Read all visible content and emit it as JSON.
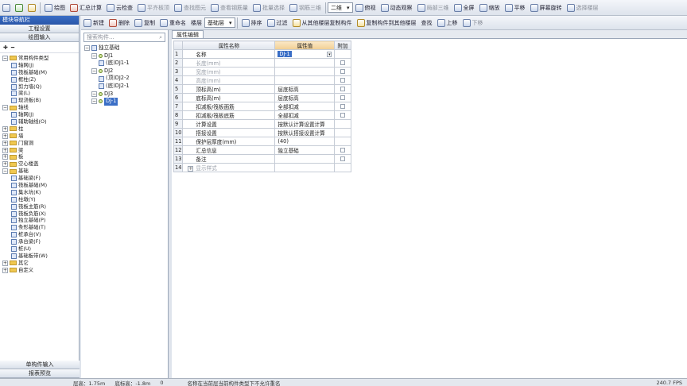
{
  "toolbar_main": {
    "items": [
      {
        "label": "",
        "icon": "open-icon"
      },
      {
        "label": "",
        "icon": "save-icon"
      },
      {
        "label": "",
        "icon": "undo-icon"
      },
      {
        "label": "绘图",
        "icon": "draw-icon"
      },
      {
        "label": "汇总计算",
        "icon": "sum-icon"
      },
      {
        "label": "云检查",
        "icon": "cloud-check-icon"
      },
      {
        "label": "平齐板顶",
        "icon": "align-icon"
      },
      {
        "label": "查找图元",
        "icon": "find-icon"
      },
      {
        "label": "查看钢筋量",
        "icon": "rebar-icon"
      },
      {
        "label": "批量选择",
        "icon": "batch-icon"
      },
      {
        "label": "钢筋三维",
        "icon": "3d-rebar-icon"
      }
    ],
    "view_mode": "二维",
    "items_right": [
      {
        "label": "俯视",
        "icon": "top-view-icon"
      },
      {
        "label": "动态观察",
        "icon": "orbit-icon"
      },
      {
        "label": "局部三维",
        "icon": "local-3d-icon"
      },
      {
        "label": "全屏",
        "icon": "fullscreen-icon"
      },
      {
        "label": "缩放",
        "icon": "zoom-icon"
      },
      {
        "label": "平移",
        "icon": "pan-icon"
      },
      {
        "label": "屏幕旋转",
        "icon": "rotate-icon"
      },
      {
        "label": "选择楼层",
        "icon": "floor-icon"
      }
    ]
  },
  "toolbar_second": {
    "items": [
      {
        "label": "新建",
        "icon": "new-icon"
      },
      {
        "label": "删除",
        "icon": "delete-icon"
      },
      {
        "label": "复制",
        "icon": "copy-icon"
      },
      {
        "label": "重命名",
        "icon": "rename-icon"
      },
      {
        "label": "楼层",
        "icon": ""
      }
    ],
    "floor_value": "基础层",
    "items_right": [
      {
        "label": "排序",
        "icon": "sort-icon"
      },
      {
        "label": "过滤",
        "icon": "filter-icon"
      },
      {
        "label": "从其他楼层复制构件",
        "icon": "copy-from-floor-icon"
      },
      {
        "label": "复制构件到其他楼层",
        "icon": "copy-to-floor-icon"
      },
      {
        "label": "查找",
        "icon": ""
      },
      {
        "label": "上移",
        "icon": "up-icon"
      },
      {
        "label": "下移",
        "icon": "down-icon"
      }
    ]
  },
  "nav": {
    "title": "模块导航栏",
    "buttons": [
      "工程设置",
      "绘图输入"
    ],
    "tree": [
      {
        "label": "常用构件类型",
        "level": 0,
        "type": "folder",
        "expanded": true
      },
      {
        "label": "轴网(J)",
        "level": 1,
        "type": "leaf"
      },
      {
        "label": "筏板基础(M)",
        "level": 1,
        "type": "leaf"
      },
      {
        "label": "框柱(Z)",
        "level": 1,
        "type": "leaf"
      },
      {
        "label": "剪力墙(Q)",
        "level": 1,
        "type": "leaf"
      },
      {
        "label": "梁(L)",
        "level": 1,
        "type": "leaf"
      },
      {
        "label": "现浇板(B)",
        "level": 1,
        "type": "leaf"
      },
      {
        "label": "轴线",
        "level": 0,
        "type": "folder",
        "expanded": true
      },
      {
        "label": "轴网(J)",
        "level": 1,
        "type": "leaf"
      },
      {
        "label": "辅助轴线(O)",
        "level": 1,
        "type": "leaf"
      },
      {
        "label": "柱",
        "level": 0,
        "type": "folder",
        "expanded": false
      },
      {
        "label": "墙",
        "level": 0,
        "type": "folder",
        "expanded": false
      },
      {
        "label": "门窗洞",
        "level": 0,
        "type": "folder",
        "expanded": false
      },
      {
        "label": "梁",
        "level": 0,
        "type": "folder",
        "expanded": false
      },
      {
        "label": "板",
        "level": 0,
        "type": "folder",
        "expanded": false
      },
      {
        "label": "空心楼盖",
        "level": 0,
        "type": "folder",
        "expanded": false
      },
      {
        "label": "基础",
        "level": 0,
        "type": "folder",
        "expanded": true
      },
      {
        "label": "基础梁(F)",
        "level": 1,
        "type": "leaf"
      },
      {
        "label": "筏板基础(M)",
        "level": 1,
        "type": "leaf"
      },
      {
        "label": "集水坑(K)",
        "level": 1,
        "type": "leaf"
      },
      {
        "label": "柱墩(Y)",
        "level": 1,
        "type": "leaf"
      },
      {
        "label": "筏板主筋(R)",
        "level": 1,
        "type": "leaf"
      },
      {
        "label": "筏板负筋(X)",
        "level": 1,
        "type": "leaf"
      },
      {
        "label": "独立基础(P)",
        "level": 1,
        "type": "leaf"
      },
      {
        "label": "条形基础(T)",
        "level": 1,
        "type": "leaf"
      },
      {
        "label": "桩承台(V)",
        "level": 1,
        "type": "leaf"
      },
      {
        "label": "承台梁(F)",
        "level": 1,
        "type": "leaf"
      },
      {
        "label": "桩(U)",
        "level": 1,
        "type": "leaf"
      },
      {
        "label": "基础板带(W)",
        "level": 1,
        "type": "leaf"
      },
      {
        "label": "其它",
        "level": 0,
        "type": "folder",
        "expanded": false
      },
      {
        "label": "自定义",
        "level": 0,
        "type": "folder",
        "expanded": false
      }
    ],
    "bottom_buttons": [
      "单构件输入",
      "报表预览"
    ]
  },
  "component_tree": {
    "search_placeholder": "搜索构件...",
    "nodes": [
      {
        "label": "独立基础",
        "level": 0,
        "type": "root"
      },
      {
        "label": "DJ1",
        "level": 1,
        "type": "item"
      },
      {
        "label": "(底)DJ1-1",
        "level": 2,
        "type": "sub"
      },
      {
        "label": "DJ2",
        "level": 1,
        "type": "item"
      },
      {
        "label": "(顶)DJ2-2",
        "level": 2,
        "type": "sub"
      },
      {
        "label": "(底)DJ2-1",
        "level": 2,
        "type": "sub"
      },
      {
        "label": "DJ3",
        "level": 1,
        "type": "item"
      },
      {
        "label": "DJ-1",
        "level": 1,
        "type": "item",
        "selected": true
      }
    ]
  },
  "properties": {
    "tab": "属性编辑",
    "headers": [
      "属性名称",
      "属性值",
      "附加"
    ],
    "rows": [
      {
        "n": "1",
        "name": "名称",
        "value": "DJ-1",
        "dim": false,
        "check": false,
        "editing": true
      },
      {
        "n": "2",
        "name": "长度(mm)",
        "value": "",
        "dim": true,
        "check": true
      },
      {
        "n": "3",
        "name": "宽度(mm)",
        "value": "",
        "dim": true,
        "check": true
      },
      {
        "n": "4",
        "name": "高度(mm)",
        "value": "",
        "dim": true,
        "check": true
      },
      {
        "n": "5",
        "name": "顶标高(m)",
        "value": "层底标高",
        "dim": false,
        "check": true
      },
      {
        "n": "6",
        "name": "底标高(m)",
        "value": "层底标高",
        "dim": false,
        "check": true
      },
      {
        "n": "7",
        "name": "扣减板/筏板面筋",
        "value": "全部扣减",
        "dim": false,
        "check": true
      },
      {
        "n": "8",
        "name": "扣减板/筏板底筋",
        "value": "全部扣减",
        "dim": false,
        "check": true
      },
      {
        "n": "9",
        "name": "计算设置",
        "value": "按默认计算设置计算",
        "dim": false,
        "check": false
      },
      {
        "n": "10",
        "name": "搭接设置",
        "value": "按默认搭接设置计算",
        "dim": false,
        "check": false
      },
      {
        "n": "11",
        "name": "保护层厚度(mm)",
        "value": "(40)",
        "dim": false,
        "check": false
      },
      {
        "n": "12",
        "name": "汇总信息",
        "value": "独立基础",
        "dim": false,
        "check": true
      },
      {
        "n": "13",
        "name": "备注",
        "value": "",
        "dim": false,
        "check": true
      },
      {
        "n": "14",
        "name": "显示样式",
        "value": "",
        "dim": true,
        "check": false,
        "expand": true
      }
    ]
  },
  "status": {
    "floor_height": "层高：1.75m",
    "bottom_elev": "底标高：-1.8m",
    "count": "0",
    "message": "名称在当前层当前构件类型下不允许重名",
    "coords": "240.7 FPS"
  }
}
